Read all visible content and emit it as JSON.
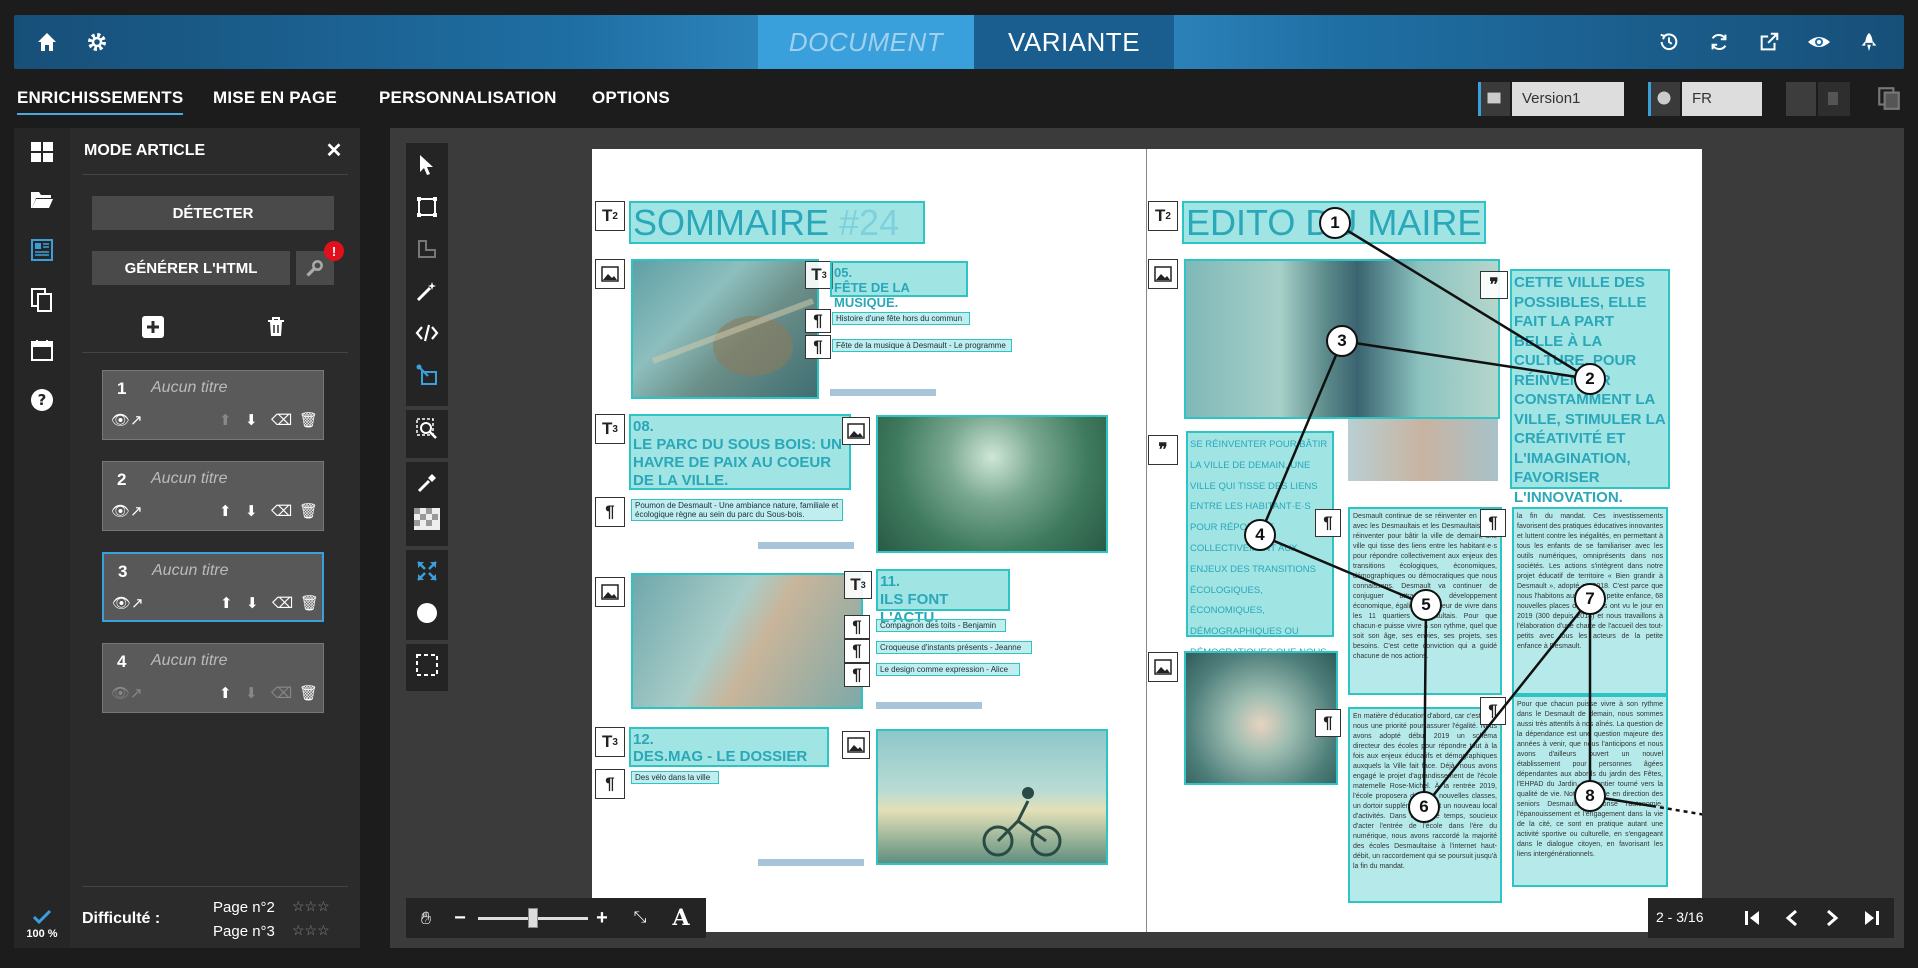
{
  "topbar": {
    "tab_document": "DOCUMENT",
    "tab_variante": "VARIANTE",
    "left_icons": [
      "home-icon",
      "gear-icon"
    ],
    "right_icons": [
      "history-icon",
      "refresh-icon",
      "external-link-icon",
      "eye-icon",
      "rocket-icon"
    ]
  },
  "menu": {
    "items": [
      "ENRICHISSEMENTS",
      "MISE EN PAGE",
      "PERSONNALISATION",
      "OPTIONS"
    ],
    "version_value": "Version1",
    "lang_value": "FR"
  },
  "panel": {
    "title": "MODE ARTICLE",
    "detect_label": "DÉTECTER",
    "generate_label": "GÉNÉRER L'HTML",
    "warning_badge": "!",
    "articles": [
      {
        "num": "1",
        "title": "Aucun titre"
      },
      {
        "num": "2",
        "title": "Aucun titre"
      },
      {
        "num": "3",
        "title": "Aucun titre"
      },
      {
        "num": "4",
        "title": "Aucun titre"
      }
    ],
    "progress": "100 %",
    "difficulty_label": "Difficulté :",
    "difficulty_pages": [
      "Page n°2",
      "Page n°3"
    ],
    "stars": "☆☆☆"
  },
  "page": {
    "left": {
      "title_main": "SOMMAIRE",
      "title_num": "#24",
      "items": [
        {
          "num": "05.",
          "title": "FÊTE DE LA MUSIQUE.",
          "subs": [
            "Histoire d'une fête hors du commun",
            "Fête de la musique à Desmault - Le programme"
          ]
        },
        {
          "num": "08.",
          "title": "LE PARC DU SOUS BOIS: UN HAVRE DE PAIX AU COEUR DE LA VILLE.",
          "subs": [
            "Poumon de Desmault - Une ambiance nature, familiale et écologique règne au sein du parc du Sous-bois."
          ]
        },
        {
          "num": "11.",
          "title": "ILS FONT L'ACTU.",
          "subs": [
            "Compagnon des toits - Benjamin",
            "Croqueuse d'instants présents - Jeanne",
            "Le design comme expression - Alice"
          ]
        },
        {
          "num": "12.",
          "title": "DES.MAG - LE DOSSIER",
          "subs": [
            "Des vélo dans la ville"
          ]
        }
      ]
    },
    "right": {
      "title": "EDITO DU MAIRE",
      "quote": "CETTE VILLE DES POSSIBLES, ELLE FAIT LA PART BELLE À LA CULTURE, POUR RÉINVENTER CONSTAMMENT LA VILLE, STIMULER LA CRÉATIVITÉ ET L'IMAGINATION, FAVORISER L'INNOVATION.",
      "pullquote": "SE RÉINVENTER POUR BÂTIR LA VILLE DE DEMAIN, UNE VILLE QUI TISSE DES LIENS ENTRE LES HABITANT·E·S POUR RÉPONDRE COLLECTIVEMENT AUX ENJEUX DES TRANSITIONS ÉCOLOGIQUES, ÉCONOMIQUES, DÉMOGRAPHIQUES OU DÉMOCRATIQUES QUE NOUS CONNAISSONS.",
      "body1": "Desmault continue de se réinventer en 2019, avec les Desmaultais et les Desmaultaise. Se réinventer pour bâtir la ville de demain, une ville qui tisse des liens entre les habitant·e·s pour répondre collectivement aux enjeux des transitions écologiques, économiques, démographiques ou démocratiques que nous connaissons. Desmault va continuer de conjuguer attractivité, développement économique, égalité et douceur de vivre dans les 11 quartiers Desmaultais. Pour que chacun·e puisse vivre à son rythme, quel que soit son âge, ses envies, ses projets, ses besoins. C'est cette conviction qui a guidé chacune de nos actions.",
      "body2": "En matière d'éducation d'abord, car c'est pour nous une priorité pour assurer l'égalité. Nous avons adopté début 2019 un schéma directeur des écoles pour répondre tout à la fois aux enjeux éducatifs et démographiques auxquels la Ville fait face. Déjà, nous avons engagé le projet d'agrandissement de l'école maternelle Rose-Michel. À la rentrée 2019, l'école proposera de deux nouvelles classes, un dortoir supplémentaire et un nouveau local d'activités. Dans le même temps, soucieux d'acter l'entrée de l'école dans l'ère du numérique, nous avons raccordé la majorité des écoles Desmaultaise à l'internet haut-débit, un raccordement qui se poursuit jusqu'à la fin du mandat.",
      "body3": "la fin du mandat. Ces investissements favorisent des pratiques éducatives innovantes et luttent contre les inégalités, en permettant à tous les enfants de se familiariser avec les outils numériques, omniprésents dans nos sociétés. Les actions s'intègrent dans notre projet éducatif de territoire « Bien grandir à Desmault », adopté en 2018. C'est parce que nous l'habitons aussi que la petite enfance, 68 nouvelles places de crèches ont vu le jour en 2019 (300 depuis 2014) et nous travaillons à l'élaboration d'une charte de l'accueil des tout-petits avec tous les acteurs de la petite enfance à Desmault.",
      "body4": "Pour que chacun puisse vivre à son rythme dans le Desmault de demain, nous sommes aussi très attentifs à nos aînés. La question de la dépendance est une question majeure des années à venir, que nous l'anticipons et nous avons d'ailleurs ouvert un nouvel établissement pour personnes âgées dépendantes aux abords du jardin des Fêtes, l'EHPAD du Jardin, tout entier tourné vers la qualité de vie. Notre politique en direction des seniors Desmaultais favorise l'autonomie, l'épanouissement et l'engagement dans la vie de la cité, ce sont en pratique autant une activité sportive ou culturelle, en s'engageant dans le dialogue citoyen, en favorisant les liens intergénérationnels.",
      "circles": [
        "1",
        "2",
        "3",
        "4",
        "5",
        "6",
        "7",
        "8"
      ]
    }
  },
  "marker_labels": {
    "title": "T",
    "title_sub": "2",
    "title3_sub": "3",
    "paragraph": "¶",
    "quote": "❞"
  },
  "pagination": {
    "label": "2 - 3/16"
  },
  "colors": {
    "accent": "#3aa0dc",
    "cyan_overlay": "#2ec4c4",
    "warning": "#e0101c"
  }
}
